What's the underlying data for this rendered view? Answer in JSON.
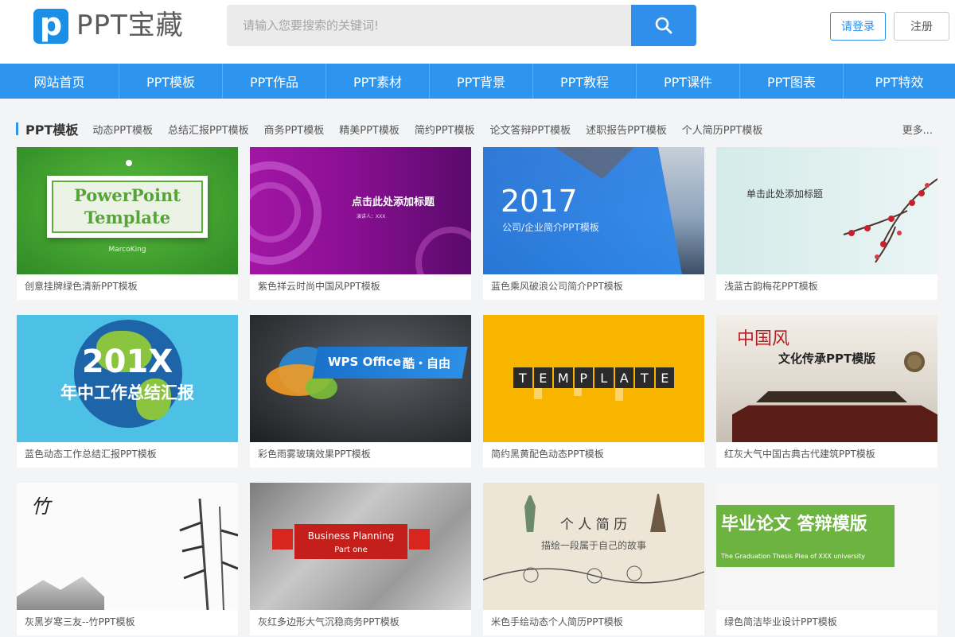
{
  "header": {
    "logo_letter": "p",
    "site_name": "PPT宝藏",
    "search_placeholder": "请输入您要搜索的关键词!",
    "login_label": "请登录",
    "register_label": "注册"
  },
  "nav": [
    "网站首页",
    "PPT模板",
    "PPT作品",
    "PPT素材",
    "PPT背景",
    "PPT教程",
    "PPT课件",
    "PPT图表",
    "PPT特效"
  ],
  "section": {
    "title": "PPT模板",
    "subcategories": [
      "动态PPT模板",
      "总结汇报PPT模板",
      "商务PPT模板",
      "精美PPT模板",
      "简约PPT模板",
      "论文答辩PPT模板",
      "述职报告PPT模板",
      "个人简历PPT模板"
    ],
    "more": "更多..."
  },
  "cards": [
    {
      "caption": "创意挂牌绿色清新PPT模板",
      "thumb": {
        "l1": "PowerPoint",
        "l2": "Template",
        "l3": "MarcoKing"
      }
    },
    {
      "caption": "紫色祥云时尚中国风PPT模板",
      "thumb": {
        "l1": "点击此处添加标题",
        "l2": "演讲人：XXX"
      }
    },
    {
      "caption": "蓝色乘风破浪公司简介PPT模板",
      "thumb": {
        "l1": "2017",
        "l2": "公司/企业简介PPT模板"
      }
    },
    {
      "caption": "浅蓝古韵梅花PPT模板",
      "thumb": {
        "l1": "单击此处添加标题"
      }
    },
    {
      "caption": "蓝色动态工作总结汇报PPT模板",
      "thumb": {
        "l1": "201X",
        "l2": "年中工作总结汇报"
      }
    },
    {
      "caption": "彩色雨雾玻璃效果PPT模板",
      "thumb": {
        "l1": "WPS Office",
        "l2": "酷・自由"
      }
    },
    {
      "caption": "简约黑黄配色动态PPT模板",
      "thumb": {
        "letters": [
          "T",
          "E",
          "M",
          "P",
          "L",
          "A",
          "T",
          "E"
        ]
      }
    },
    {
      "caption": "红灰大气中国古典古代建筑PPT模板",
      "thumb": {
        "l1": "中国风",
        "l2": "文化传承PPT模版"
      }
    },
    {
      "caption": "灰黑岁寒三友--竹PPT模板",
      "thumb": {
        "l1": "竹"
      }
    },
    {
      "caption": "灰红多边形大气沉稳商务PPT模板",
      "thumb": {
        "l1": "Business Planning",
        "l2": "Part one"
      }
    },
    {
      "caption": "米色手绘动态个人简历PPT模板",
      "thumb": {
        "l1": "个 人 简 历",
        "l2": "描绘一段属于自己的故事"
      }
    },
    {
      "caption": "绿色简洁毕业设计PPT模板",
      "thumb": {
        "l1": "毕业论文 答辩模版",
        "l2": "The Graduation Thesis Plea of XXX university"
      }
    }
  ],
  "colors": {
    "accent": "#2e95ee",
    "logo": "#1b8fe6",
    "background": "#f3f4f6"
  }
}
